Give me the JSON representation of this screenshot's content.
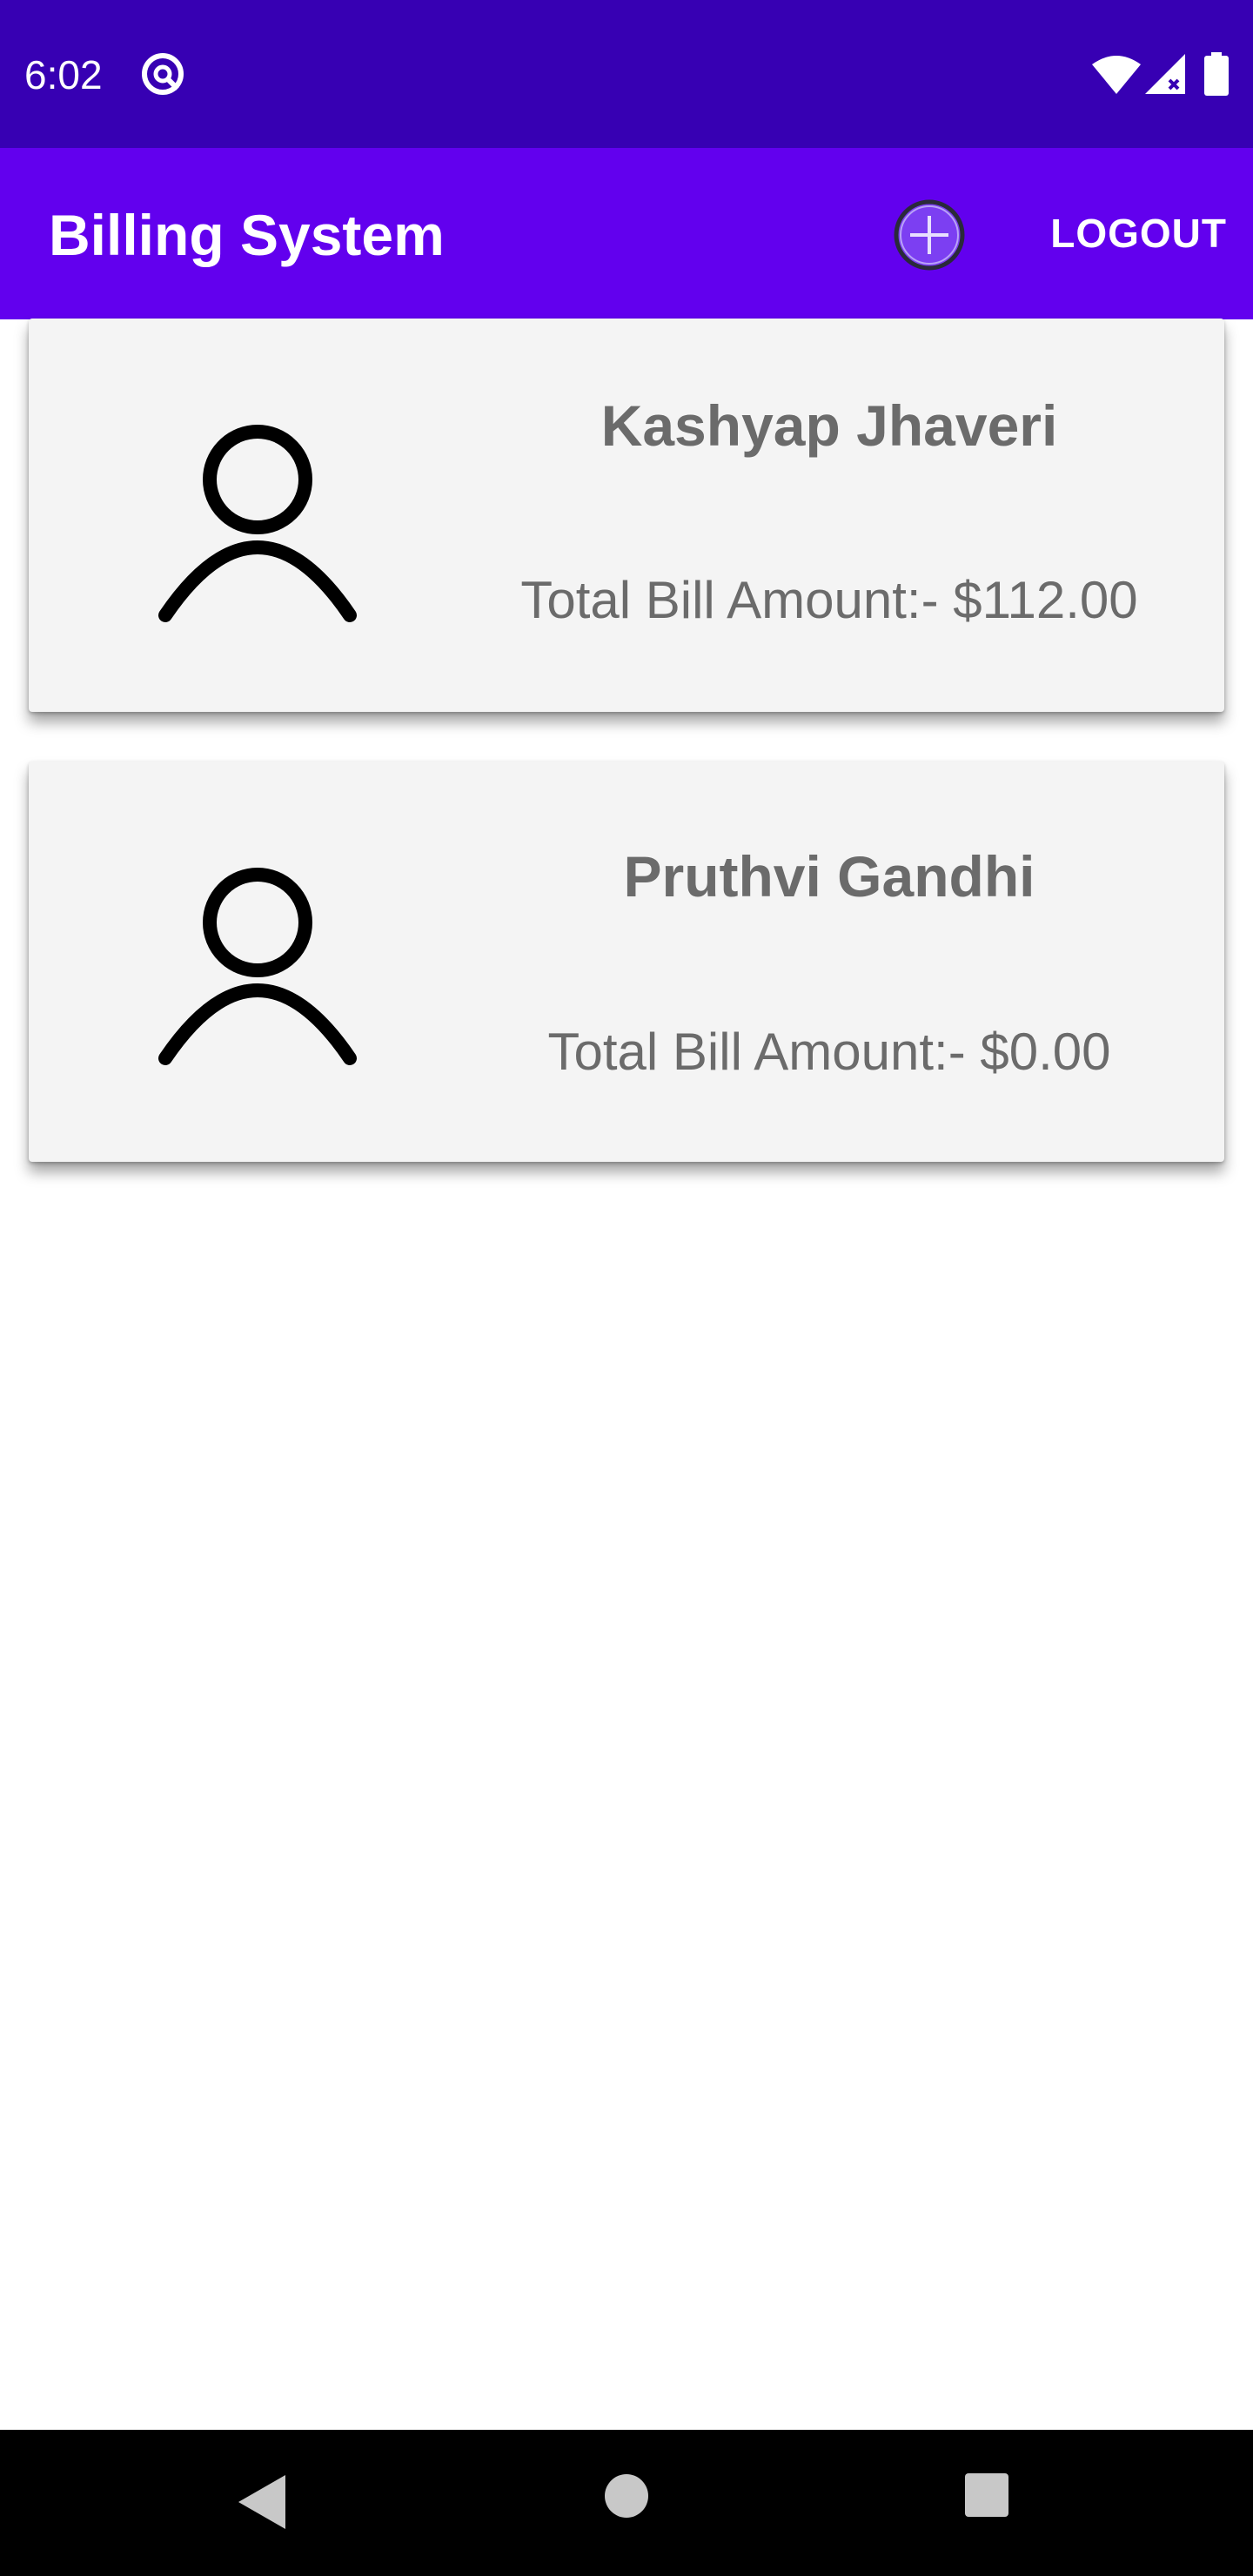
{
  "status_bar": {
    "time": "6:02",
    "icons": [
      "app-notification-icon",
      "wifi-icon",
      "cell-signal-icon",
      "battery-icon"
    ]
  },
  "app_bar": {
    "title": "Billing System",
    "add_icon": "add-circle-icon",
    "logout_label": "LOGOUT"
  },
  "customers": [
    {
      "name": "Kashyap Jhaveri",
      "bill_text": "Total Bill Amount:- $112.00",
      "icon": "person-icon"
    },
    {
      "name": "Pruthvi Gandhi",
      "bill_text": "Total Bill Amount:- $0.00",
      "icon": "person-icon"
    }
  ],
  "nav_bar": {
    "icons": [
      "back-icon",
      "home-icon",
      "recents-icon"
    ]
  },
  "colors": {
    "status_bar": "#3700b3",
    "app_bar": "#6200ee",
    "card_background": "#f4f4f4",
    "card_text": "#6b6b6b"
  }
}
